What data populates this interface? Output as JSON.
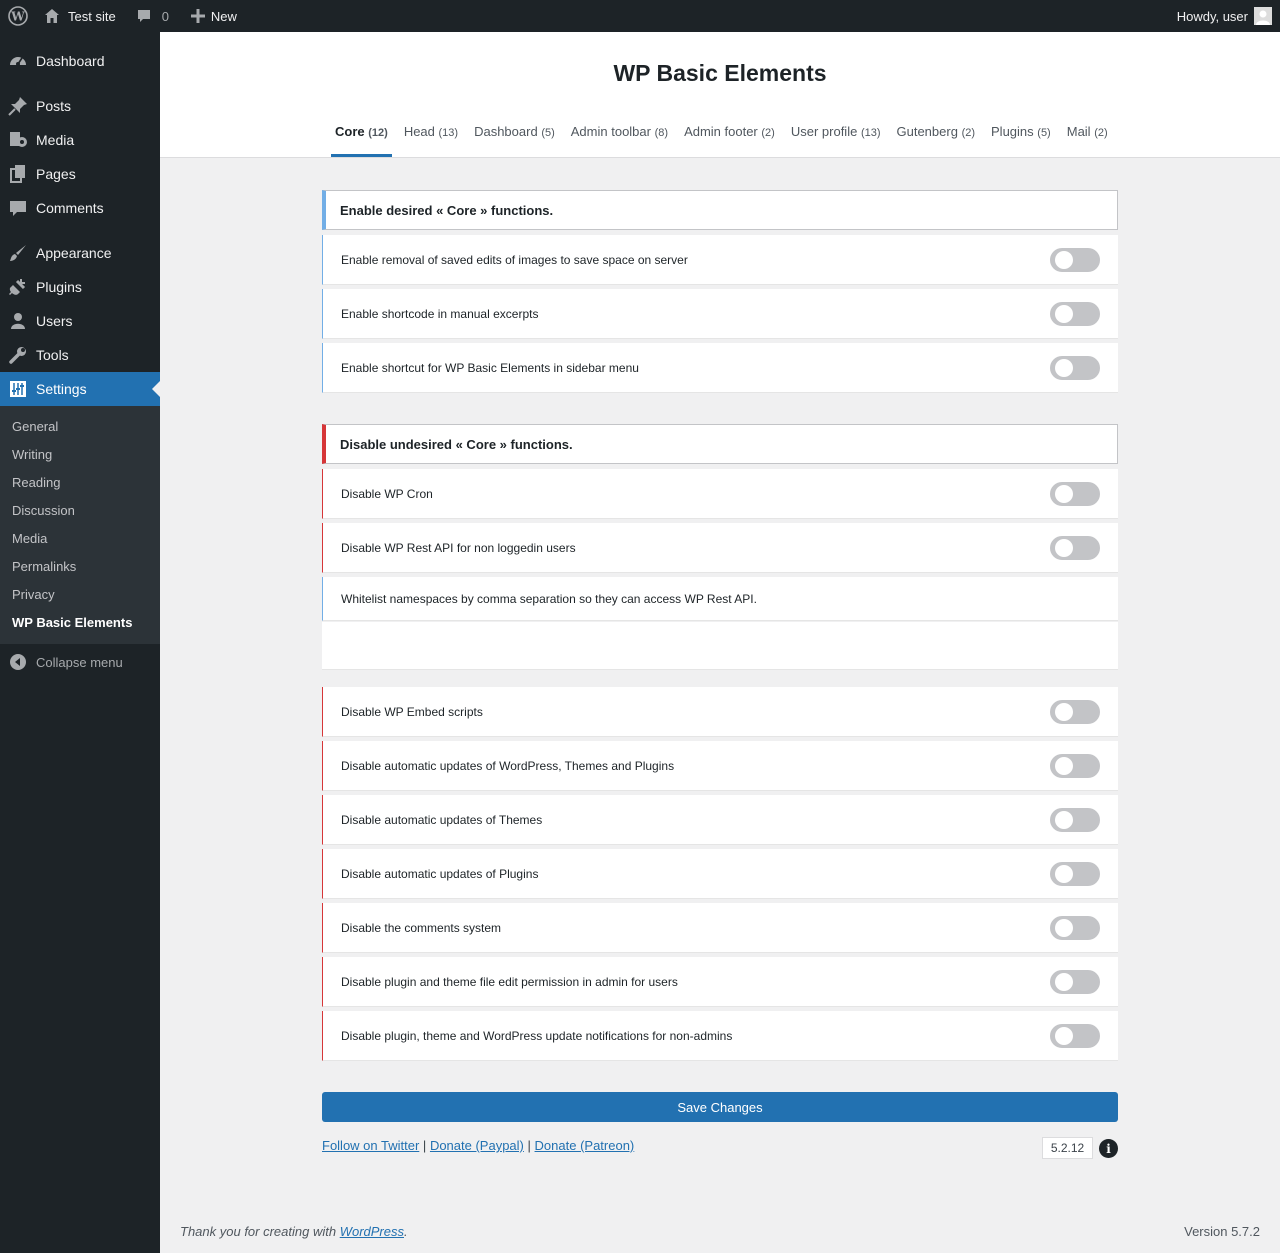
{
  "adminbar": {
    "site_name": "Test site",
    "comments_count": "0",
    "new_label": "New",
    "howdy": "Howdy, user"
  },
  "sidebar": {
    "items": [
      {
        "label": "Dashboard",
        "icon": "dashboard-icon"
      },
      {
        "label": "Posts",
        "icon": "pin-icon"
      },
      {
        "label": "Media",
        "icon": "media-icon"
      },
      {
        "label": "Pages",
        "icon": "pages-icon"
      },
      {
        "label": "Comments",
        "icon": "comment-icon"
      },
      {
        "label": "Appearance",
        "icon": "brush-icon"
      },
      {
        "label": "Plugins",
        "icon": "plug-icon"
      },
      {
        "label": "Users",
        "icon": "user-icon"
      },
      {
        "label": "Tools",
        "icon": "wrench-icon"
      },
      {
        "label": "Settings",
        "icon": "settings-icon"
      }
    ],
    "submenu": [
      "General",
      "Writing",
      "Reading",
      "Discussion",
      "Media",
      "Permalinks",
      "Privacy",
      "WP Basic Elements"
    ],
    "collapse": "Collapse menu"
  },
  "page": {
    "title": "WP Basic Elements",
    "tabs": [
      {
        "label": "Core",
        "count": "(12)"
      },
      {
        "label": "Head",
        "count": "(13)"
      },
      {
        "label": "Dashboard",
        "count": "(5)"
      },
      {
        "label": "Admin toolbar",
        "count": "(8)"
      },
      {
        "label": "Admin footer",
        "count": "(2)"
      },
      {
        "label": "User profile",
        "count": "(13)"
      },
      {
        "label": "Gutenberg",
        "count": "(2)"
      },
      {
        "label": "Plugins",
        "count": "(5)"
      },
      {
        "label": "Mail",
        "count": "(2)"
      }
    ],
    "enable_heading": "Enable desired « Core » functions.",
    "enable_options": [
      "Enable removal of saved edits of images to save space on server",
      "Enable shortcode in manual excerpts",
      "Enable shortcut for WP Basic Elements in sidebar menu"
    ],
    "disable_heading": "Disable undesired « Core » functions.",
    "disable_options_a": [
      "Disable WP Cron",
      "Disable WP Rest API for non loggedin users"
    ],
    "whitelist_label": "Whitelist namespaces by comma separation so they can access WP Rest API.",
    "disable_options_b": [
      "Disable WP Embed scripts",
      "Disable automatic updates of WordPress, Themes and Plugins",
      "Disable automatic updates of Themes",
      "Disable automatic updates of Plugins",
      "Disable the comments system",
      "Disable plugin and theme file edit permission in admin for users",
      "Disable plugin, theme and WordPress update notifications for non-admins"
    ],
    "save_label": "Save Changes",
    "links": {
      "twitter": "Follow on Twitter",
      "paypal": "Donate (Paypal)",
      "patreon": "Donate (Patreon)",
      "separator": "|"
    },
    "plugin_version": "5.2.12",
    "info_glyph": "i"
  },
  "footer": {
    "thanks_prefix": "Thank you for creating with ",
    "thanks_link": "WordPress",
    "thanks_suffix": ".",
    "version": "Version 5.7.2"
  },
  "colors": {
    "accent": "#2271b1",
    "enable_border": "#72aee6",
    "disable_border": "#d63638",
    "sidebar_bg": "#1d2327"
  }
}
